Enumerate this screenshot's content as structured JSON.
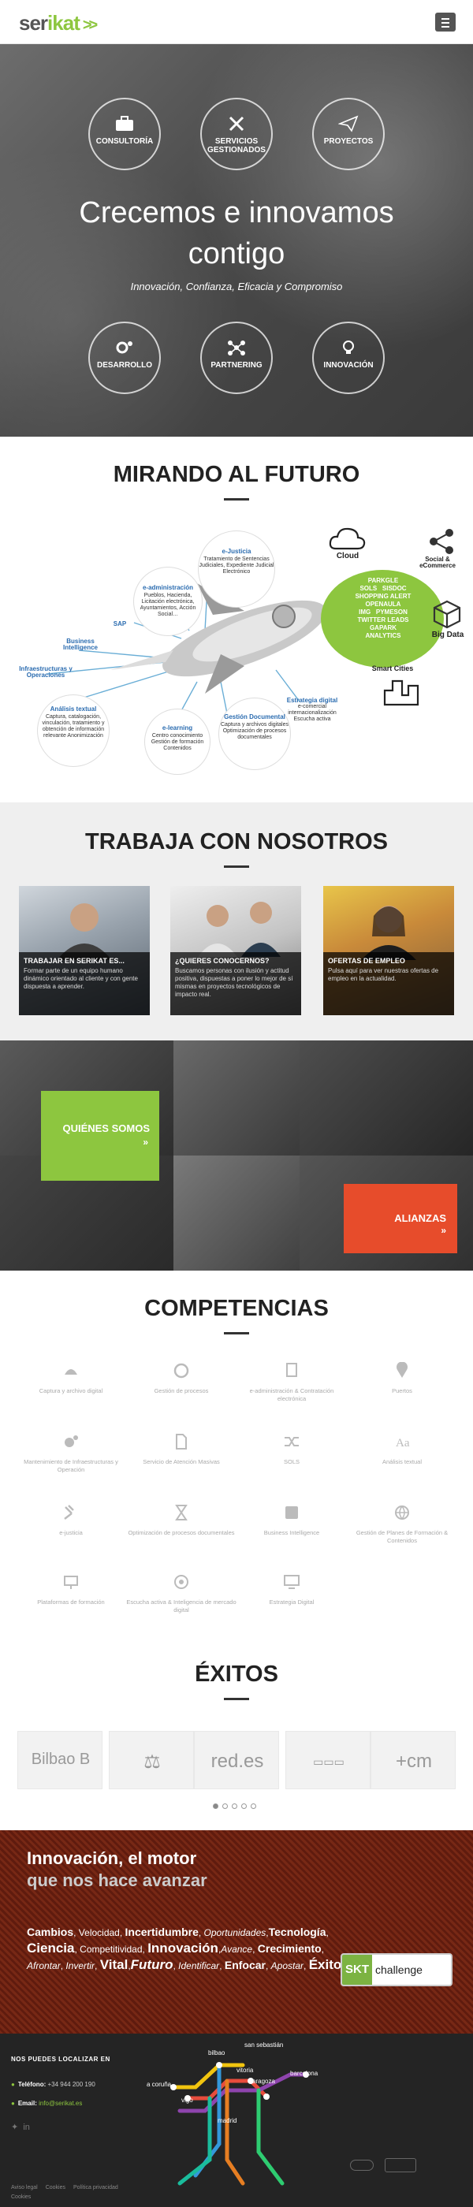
{
  "header": {
    "logo_a": "ser",
    "logo_b": "ikat",
    "logo_chev": ">>"
  },
  "hero": {
    "services_top": [
      "CONSULTORÍA",
      "SERVICIOS GESTIONADOS",
      "PROYECTOS"
    ],
    "services_bottom": [
      "DESARROLLO",
      "PARTNERING",
      "INNOVACIÓN"
    ],
    "title_line1": "Crecemos e innovamos",
    "title_line2": "contigo",
    "subtitle": "Innovación, Confianza, Eficacia y Compromiso"
  },
  "future": {
    "title": "MIRANDO AL FUTURO",
    "ejusticia_t": "e-Justicia",
    "ejusticia_d": "Tratamiento de Sentencias Judiciales, Expediente Judicial Electrónico",
    "eadmin_t": "e-administración",
    "eadmin_d": "Pueblos, Hacienda, Licitación electrónica, Ayuntamientos, Acción Social…",
    "sap": "SAP",
    "bi": "Business Intelligence",
    "infra": "Infraestructuras y Operaciones",
    "analisis_t": "Análisis textual",
    "analisis_d": "Captura, catalogación, vinculación, tratamiento y obtención de información relevante Anonimización",
    "elearning_t": "e-learning",
    "elearning_d": "Centro conocimiento Gestión de formación Contenidos",
    "gestion_t": "Gestión Documental",
    "gestion_d": "Captura y archivos digitales Optimización de procesos documentales",
    "estrategia_t": "Estrategia digital",
    "estrategia_d": "e-comercial internacionalización Escucha activa",
    "cloud": "Cloud",
    "social": "Social & eCommerce",
    "bigdata": "Big Data",
    "smartcities": "Smart Cities",
    "green_words": [
      "PARKGLE",
      "SOLS",
      "SISDOC",
      "SHOPPING ALERT",
      "OPENAULA",
      "IMG",
      "PYMESON",
      "TWITTER LEADS",
      "GAPARK",
      "ANALYTICS"
    ]
  },
  "trabaja": {
    "title": "TRABAJA CON NOSOTROS",
    "cards": [
      {
        "title": "TRABAJAR EN SERIKAT ES...",
        "desc": "Formar parte de un equipo humano dinámico orientado al cliente y con gente dispuesta a aprender."
      },
      {
        "title": "¿QUIERES CONOCERNOS?",
        "desc": "Buscamos personas con ilusión y actitud positiva, dispuestas a poner lo mejor de sí mismas en proyectos tecnológicos de impacto real."
      },
      {
        "title": "OFERTAS DE EMPLEO",
        "desc": "Pulsa aquí para ver nuestras ofertas de empleo en la actualidad."
      }
    ]
  },
  "office": {
    "quienes": "QUIÉNES SOMOS",
    "alianzas": "ALIANZAS",
    "arrows": "»"
  },
  "competencias": {
    "title": "COMPETENCIAS",
    "items": [
      "Captura y archivo digital",
      "Gestión de procesos",
      "e-administración & Contratación electrónica",
      "Puertos",
      "Mantenimiento de Infraestructuras y Operación",
      "Servicio de Atención Masivas",
      "SOLS",
      "Análisis textual",
      "e-justicia",
      "Optimización de procesos documentales",
      "Business Intelligence",
      "Gestión de Planes de Formación & Contenidos",
      "Plataformas de formación",
      "Escucha activa & Inteligencia de mercado digital",
      "Estrategia Digital"
    ]
  },
  "exitos": {
    "title": "ÉXITOS",
    "logos": [
      "Bilbao B",
      "⚖",
      "red.es",
      "▭▭▭",
      "+cm"
    ]
  },
  "innovacion": {
    "line1": "Innovación, el motor",
    "line2": "que nos hace avanzar",
    "skt_a": "SKT",
    "skt_b": "challenge",
    "words": [
      [
        "Cambios",
        "b"
      ],
      [
        ", ",
        ""
      ],
      [
        "Velocidad",
        ""
      ],
      [
        ", ",
        ""
      ],
      [
        "Incertidumbre",
        "b2"
      ],
      [
        ", ",
        ""
      ],
      [
        "Oportunidades",
        "i"
      ],
      [
        ",",
        ""
      ],
      [
        "Tecnología",
        "b2"
      ],
      [
        ", ",
        ""
      ],
      [
        "Ciencia",
        "bb"
      ],
      [
        ", ",
        ""
      ],
      [
        "Competitividad",
        ""
      ],
      [
        ", ",
        ""
      ],
      [
        "Innovación",
        "bb"
      ],
      [
        ",",
        ""
      ],
      [
        "Avance",
        "i"
      ],
      [
        ", ",
        ""
      ],
      [
        "Crecimiento",
        "b"
      ],
      [
        ", ",
        ""
      ],
      [
        "Afrontar",
        "i"
      ],
      [
        ", ",
        ""
      ],
      [
        "Invertir",
        "i"
      ],
      [
        ", ",
        ""
      ],
      [
        "Vital",
        "bb"
      ],
      [
        ",",
        ""
      ],
      [
        "Futuro",
        "bb i2"
      ],
      [
        ", ",
        ""
      ],
      [
        "Identificar",
        "i"
      ],
      [
        ", ",
        ""
      ],
      [
        "Enfocar",
        "b"
      ],
      [
        ", ",
        ""
      ],
      [
        "Apostar",
        "i"
      ],
      [
        ", ",
        ""
      ],
      [
        "Éxito",
        "bb"
      ]
    ]
  },
  "footer": {
    "title": "NOS PUEDES LOCALIZAR EN",
    "tel_label": "Teléfono:",
    "tel": "+34 944 200 190",
    "email_label": "Email:",
    "email": "info@serikat.es",
    "cities": [
      "bilbao",
      "san sebastián",
      "vitoria",
      "zaragoza",
      "barcelona",
      "a coruña",
      "vigo",
      "madrid"
    ],
    "links": [
      "Aviso legal",
      "Cookies",
      "Política privacidad",
      "Cookies"
    ]
  },
  "colors": {
    "green": "#8dc63f",
    "red": "#e74c2b",
    "blue": "#2b6cb0"
  }
}
